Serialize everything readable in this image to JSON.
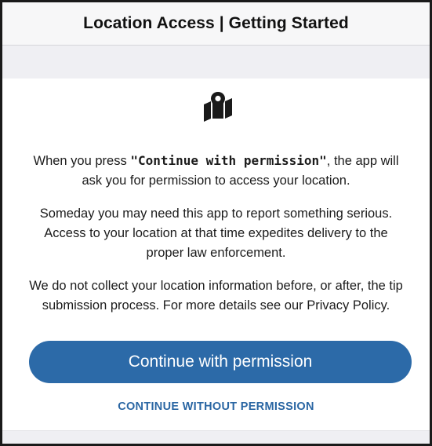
{
  "header": {
    "title": "Location Access | Getting Started"
  },
  "icon": {
    "name": "map-location-icon"
  },
  "body": {
    "p1_prefix": "When you press ",
    "p1_quote_open": "\"",
    "p1_bold": "Continue with permission",
    "p1_quote_close": "\"",
    "p1_suffix": ", the app will ask you for permission to access your location.",
    "p2": "Someday you may need this app to report something serious. Access to your location at that time expedites delivery to the proper law enforcement.",
    "p3": "We do not collect your location information before, or after, the tip submission process. For more details see our Privacy Policy."
  },
  "actions": {
    "primary_label": "Continue with permission",
    "secondary_label": "CONTINUE WITHOUT PERMISSION"
  },
  "colors": {
    "accent": "#2c6aa8",
    "link": "#2a66a3",
    "nav_bg": "#f7f7f8",
    "band_bg": "#efeff3"
  }
}
